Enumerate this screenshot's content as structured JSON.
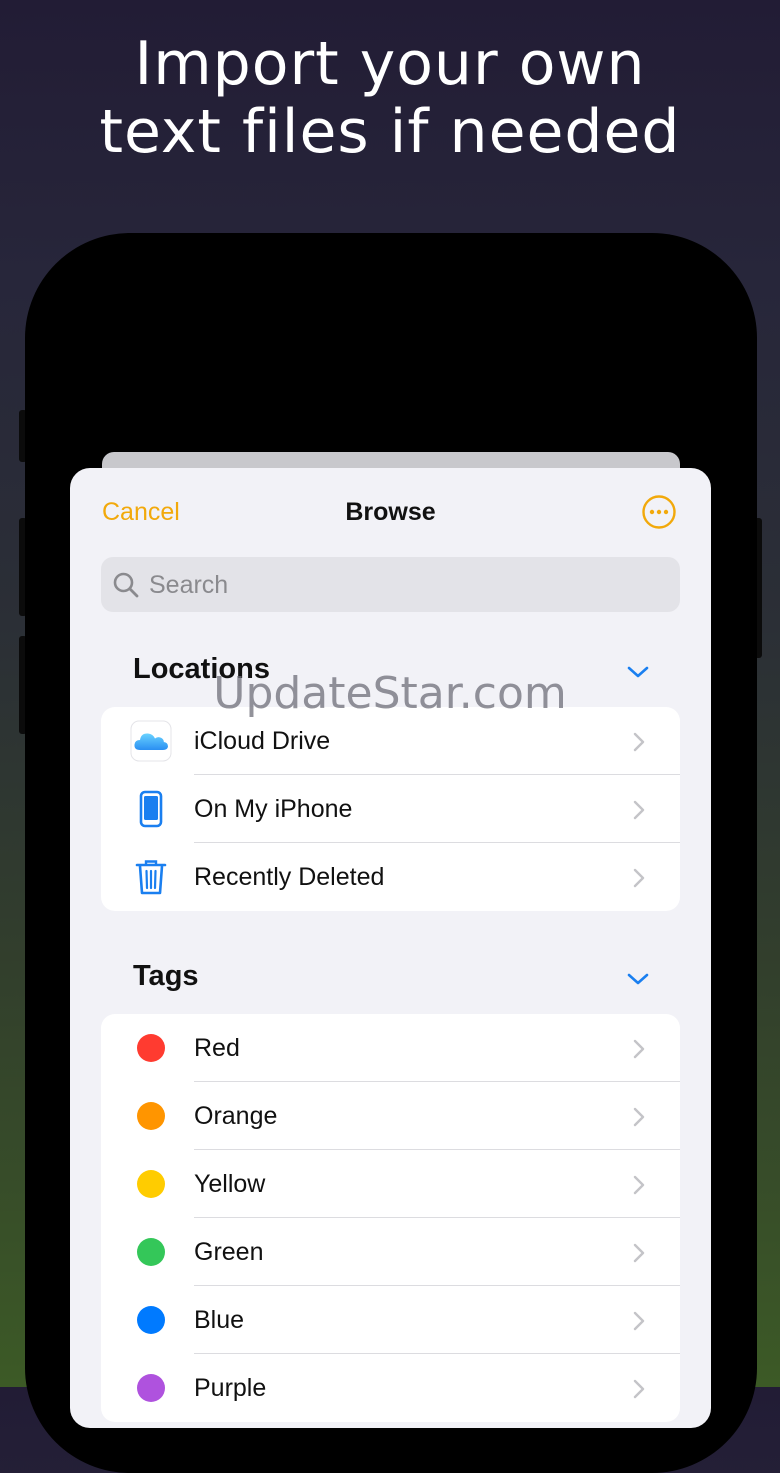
{
  "headline": {
    "line1": "Import your own",
    "line2": "text files if needed"
  },
  "nav": {
    "cancel_label": "Cancel",
    "title": "Browse",
    "more_icon": "ellipsis-circle-icon"
  },
  "search": {
    "placeholder": "Search",
    "value": ""
  },
  "locations": {
    "heading": "Locations",
    "items": [
      {
        "label": "iCloud Drive",
        "icon": "icloud-icon"
      },
      {
        "label": "On My iPhone",
        "icon": "iphone-icon"
      },
      {
        "label": "Recently Deleted",
        "icon": "trash-icon"
      }
    ]
  },
  "tags": {
    "heading": "Tags",
    "items": [
      {
        "label": "Red",
        "color": "#ff3b30"
      },
      {
        "label": "Orange",
        "color": "#ff9500"
      },
      {
        "label": "Yellow",
        "color": "#ffcc00"
      },
      {
        "label": "Green",
        "color": "#34c759"
      },
      {
        "label": "Blue",
        "color": "#007aff"
      },
      {
        "label": "Purple",
        "color": "#af52de"
      }
    ]
  },
  "watermark": "UpdateStar.com",
  "colors": {
    "accent": "#f2a90b",
    "link_blue": "#1a7ff0"
  }
}
